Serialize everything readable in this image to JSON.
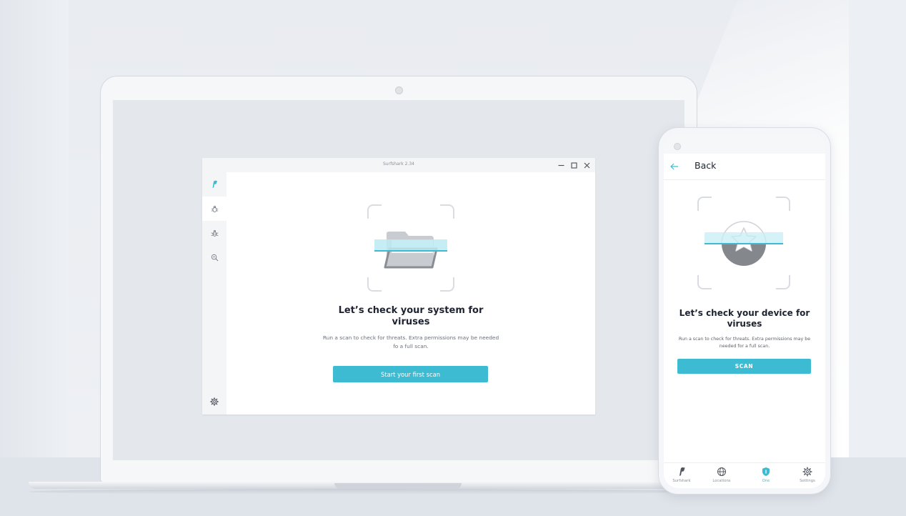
{
  "desktop_app": {
    "window_title": "Surfshark 2.34",
    "window_controls": {
      "minimize": "—",
      "maximize": "☐",
      "close": "✕"
    },
    "sidebar": {
      "items": [
        {
          "icon": "surfshark-logo-icon"
        },
        {
          "icon": "bug-icon"
        },
        {
          "icon": "bug-scan-icon"
        },
        {
          "icon": "magnifier-minus-icon"
        },
        {
          "icon": "settings-gear-icon"
        }
      ]
    },
    "main": {
      "headline": "Let’s check your system for viruses",
      "description": "Run a scan to check for threats. Extra permissions may be needed fo a full scan.",
      "button_label": "Start your first scan"
    }
  },
  "mobile_app": {
    "header": {
      "back_label": "Back"
    },
    "main": {
      "headline": "Let’s check your device for viruses",
      "description": "Run a scan to check for threats. Extra permissions may be needed for a full scan.",
      "button_label": "SCAN"
    },
    "bottom_nav": {
      "items": [
        {
          "label": "Surfshark",
          "icon": "surfshark-logo-icon",
          "active": false
        },
        {
          "label": "Locations",
          "icon": "globe-icon",
          "active": false
        },
        {
          "label": "One",
          "icon": "shield-one-icon",
          "active": true
        },
        {
          "label": "Settings",
          "icon": "gear-icon",
          "active": false
        }
      ]
    }
  },
  "colors": {
    "accent": "#3dbbd3",
    "text_dark": "#1d2330",
    "text_muted": "#6a707a",
    "illustration_gray": "#8a8e94"
  }
}
